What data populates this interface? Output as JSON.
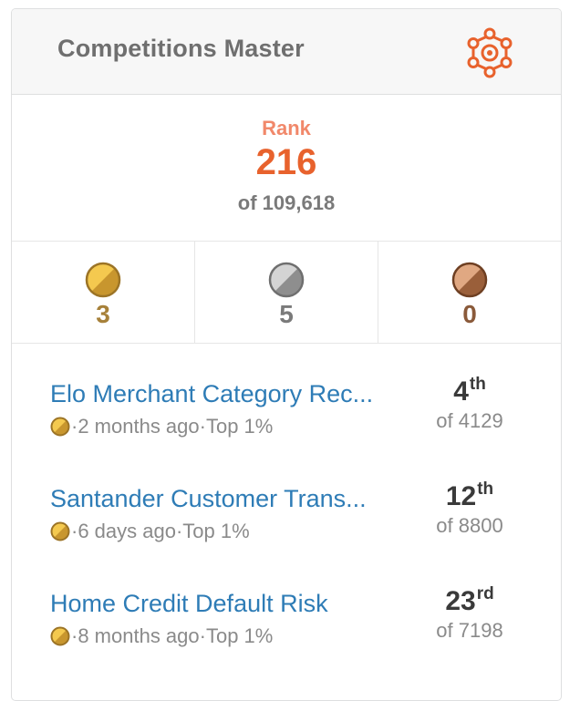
{
  "header": {
    "title": "Competitions Master",
    "tier_icon": "grandmaster-network-icon",
    "tier_color": "#e8622d"
  },
  "rank": {
    "label": "Rank",
    "value": "216",
    "of": "of 109,618"
  },
  "medals": [
    {
      "name": "gold",
      "count": "3",
      "color": "#f1c04a",
      "count_color": "#a7813a"
    },
    {
      "name": "silver",
      "count": "5",
      "color": "#a9a9a9",
      "count_color": "#7a7a7a"
    },
    {
      "name": "bronze",
      "count": "0",
      "color": "#c48a5f",
      "count_color": "#8a5a3a"
    }
  ],
  "competitions": [
    {
      "name": "Elo Merchant Category Rec...",
      "ago": "2 months ago",
      "sep": "·",
      "top": "Top 1%",
      "place": "4",
      "suffix": "th",
      "of": "of 4129"
    },
    {
      "name": "Santander Customer Trans...",
      "ago": "6 days ago",
      "sep": "·",
      "top": "Top 1%",
      "place": "12",
      "suffix": "th",
      "of": "of 8800"
    },
    {
      "name": "Home Credit Default Risk",
      "ago": "8 months ago",
      "sep": "·",
      "top": "Top 1%",
      "place": "23",
      "suffix": "rd",
      "of": "of 7198"
    }
  ]
}
